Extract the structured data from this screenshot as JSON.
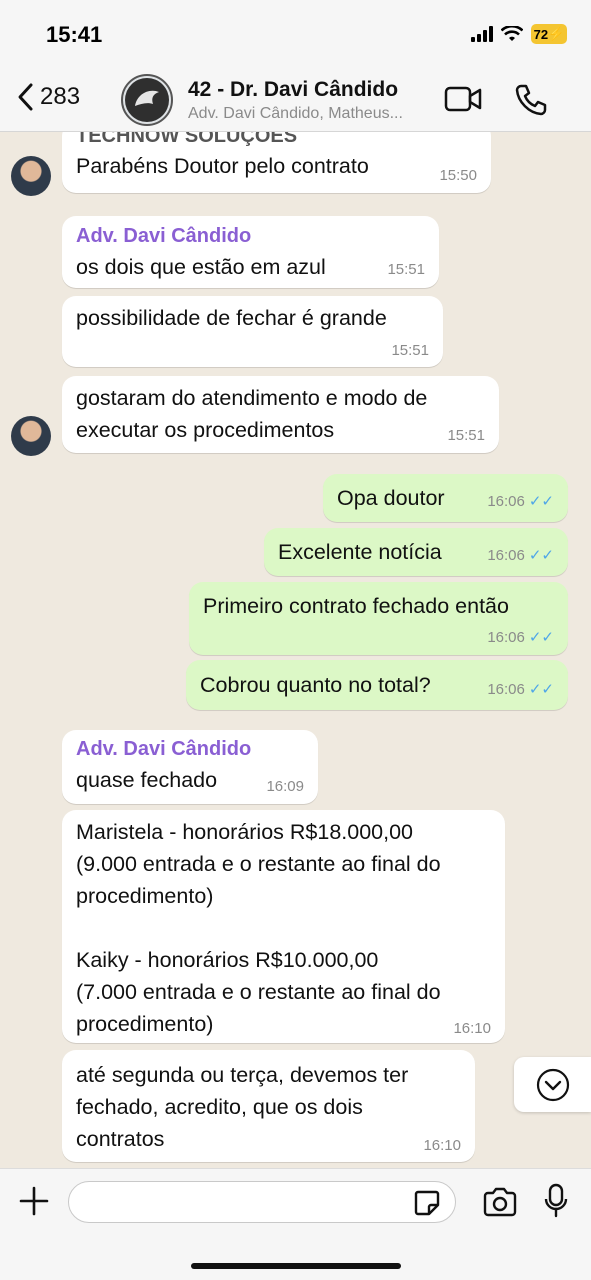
{
  "status": {
    "time": "15:41",
    "battery": "72"
  },
  "header": {
    "back_count": "283",
    "title": "42 - Dr. Davi Cândido",
    "subtitle": "Adv. Davi Cândido, Matheus..."
  },
  "messages": [
    {
      "sender": "TECHNOW SOLUÇOES",
      "text": "Parabéns Doutor pelo contrato",
      "time": "15:50"
    },
    {
      "sender": "Adv. Davi Cândido",
      "text": "os dois que estão em azul",
      "time": "15:51"
    },
    {
      "text": "possibilidade de fechar é grande",
      "time": "15:51"
    },
    {
      "line1": "gostaram do atendimento e modo de",
      "line2": "executar os procedimentos",
      "time": "15:51"
    },
    {
      "text": "Opa doutor",
      "time": "16:06"
    },
    {
      "text": "Excelente notícia",
      "time": "16:06"
    },
    {
      "text": "Primeiro contrato fechado então",
      "time": "16:06"
    },
    {
      "text": "Cobrou quanto no total?",
      "time": "16:06"
    },
    {
      "sender": "Adv. Davi Cândido",
      "text": "quase fechado",
      "time": "16:09"
    },
    {
      "lines": [
        "Maristela - honorários R$18.000,00",
        "(9.000 entrada e o restante ao final do",
        "procedimento)",
        "Kaiky - honorários R$10.000,00",
        "(7.000 entrada e o restante ao final do",
        "procedimento)"
      ],
      "time": "16:10"
    },
    {
      "lines": [
        "até segunda ou terça, devemos ter",
        "fechado, acredito, que os dois",
        "contratos"
      ],
      "time": "16:10"
    }
  ],
  "read_ticks": "✓✓",
  "icons": {
    "back": "chevron-left-icon",
    "video": "video-camera-icon",
    "phone": "phone-icon",
    "plus": "plus-icon",
    "sticker": "sticker-icon",
    "camera": "camera-icon",
    "mic": "microphone-icon",
    "scroll": "chevron-down-icon"
  },
  "colors": {
    "outgoing": "#dcf8c6",
    "incoming": "#ffffff",
    "sender": "#8a5fd3",
    "ticks": "#4fa6e8",
    "battery": "#f4c531"
  }
}
